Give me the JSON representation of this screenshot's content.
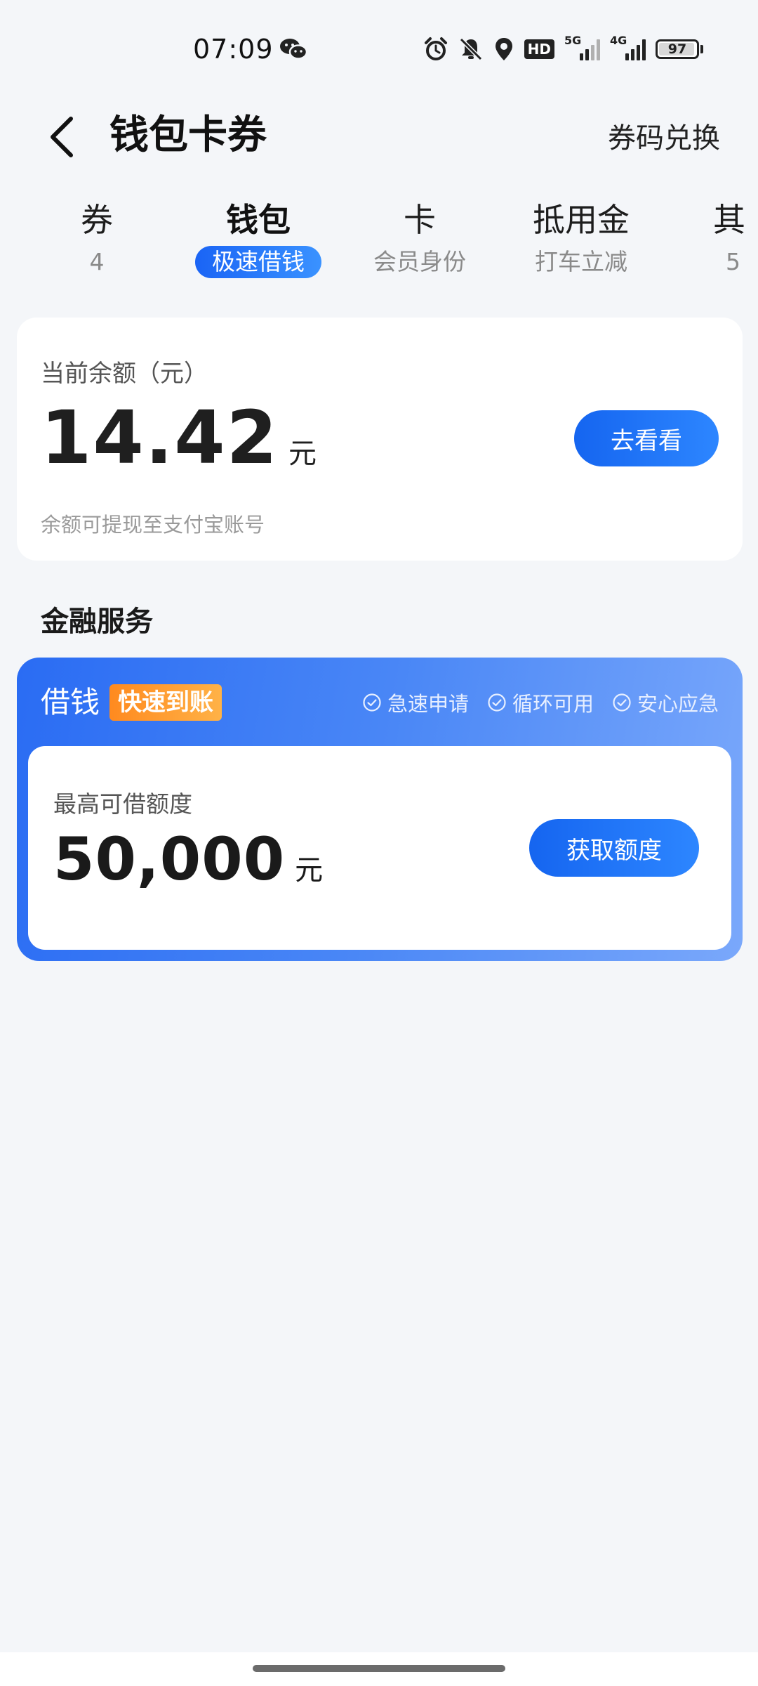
{
  "status_bar": {
    "time": "07:09",
    "hd_label": "HD",
    "net_5g": "5G",
    "net_4g": "4G",
    "battery_level": 97,
    "battery_text": "97",
    "icons": [
      "wechat-icon",
      "alarm-icon",
      "mute-bell-icon",
      "location-icon",
      "hd-icon",
      "signal-5g-icon",
      "signal-4g-icon",
      "battery-icon"
    ]
  },
  "header": {
    "title": "钱包卡券",
    "redeem_label": "券码兑换"
  },
  "tabs": [
    {
      "label": "券",
      "sub": "4"
    },
    {
      "label": "钱包",
      "sub": "极速借钱"
    },
    {
      "label": "卡",
      "sub": "会员身份"
    },
    {
      "label": "抵用金",
      "sub": "打车立减"
    },
    {
      "label": "其",
      "sub": "5"
    }
  ],
  "active_tab_index": 1,
  "balance": {
    "label": "当前余额（元）",
    "amount": "14.42",
    "unit": "元",
    "button_label": "去看看",
    "hint": "余额可提现至支付宝账号"
  },
  "financial": {
    "section_title": "金融服务",
    "loan_title": "借钱",
    "badge": "快速到账",
    "features": [
      "急速申请",
      "循环可用",
      "安心应急"
    ],
    "limit_label": "最高可借额度",
    "limit_amount": "50,000",
    "limit_unit": "元",
    "button_label": "获取额度"
  },
  "colors": {
    "primary_blue": "#1a64f5",
    "badge_orange": "#ff8a1f",
    "background": "#f4f6f9"
  }
}
